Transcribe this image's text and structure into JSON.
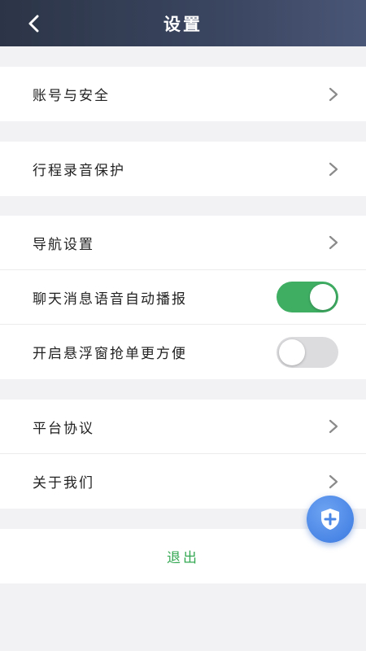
{
  "header": {
    "title": "设置",
    "back_icon": "chevron-left-icon"
  },
  "groups": [
    {
      "items": [
        {
          "label": "账号与安全",
          "type": "link"
        }
      ]
    },
    {
      "items": [
        {
          "label": "行程录音保护",
          "type": "link"
        }
      ]
    },
    {
      "items": [
        {
          "label": "导航设置",
          "type": "link"
        },
        {
          "label": "聊天消息语音自动播报",
          "type": "toggle",
          "on": true
        },
        {
          "label": "开启悬浮窗抢单更方便",
          "type": "toggle",
          "on": false
        }
      ]
    },
    {
      "items": [
        {
          "label": "平台协议",
          "type": "link"
        },
        {
          "label": "关于我们",
          "type": "link"
        }
      ]
    }
  ],
  "logout": {
    "label": "退出"
  },
  "fab": {
    "icon": "shield-plus-icon"
  },
  "colors": {
    "header_start": "#2c3547",
    "header_end": "#4a5676",
    "toggle_on": "#3fae63",
    "toggle_off": "#dcdcdf",
    "logout_text": "#35a853",
    "fab": "#4a86e6"
  }
}
